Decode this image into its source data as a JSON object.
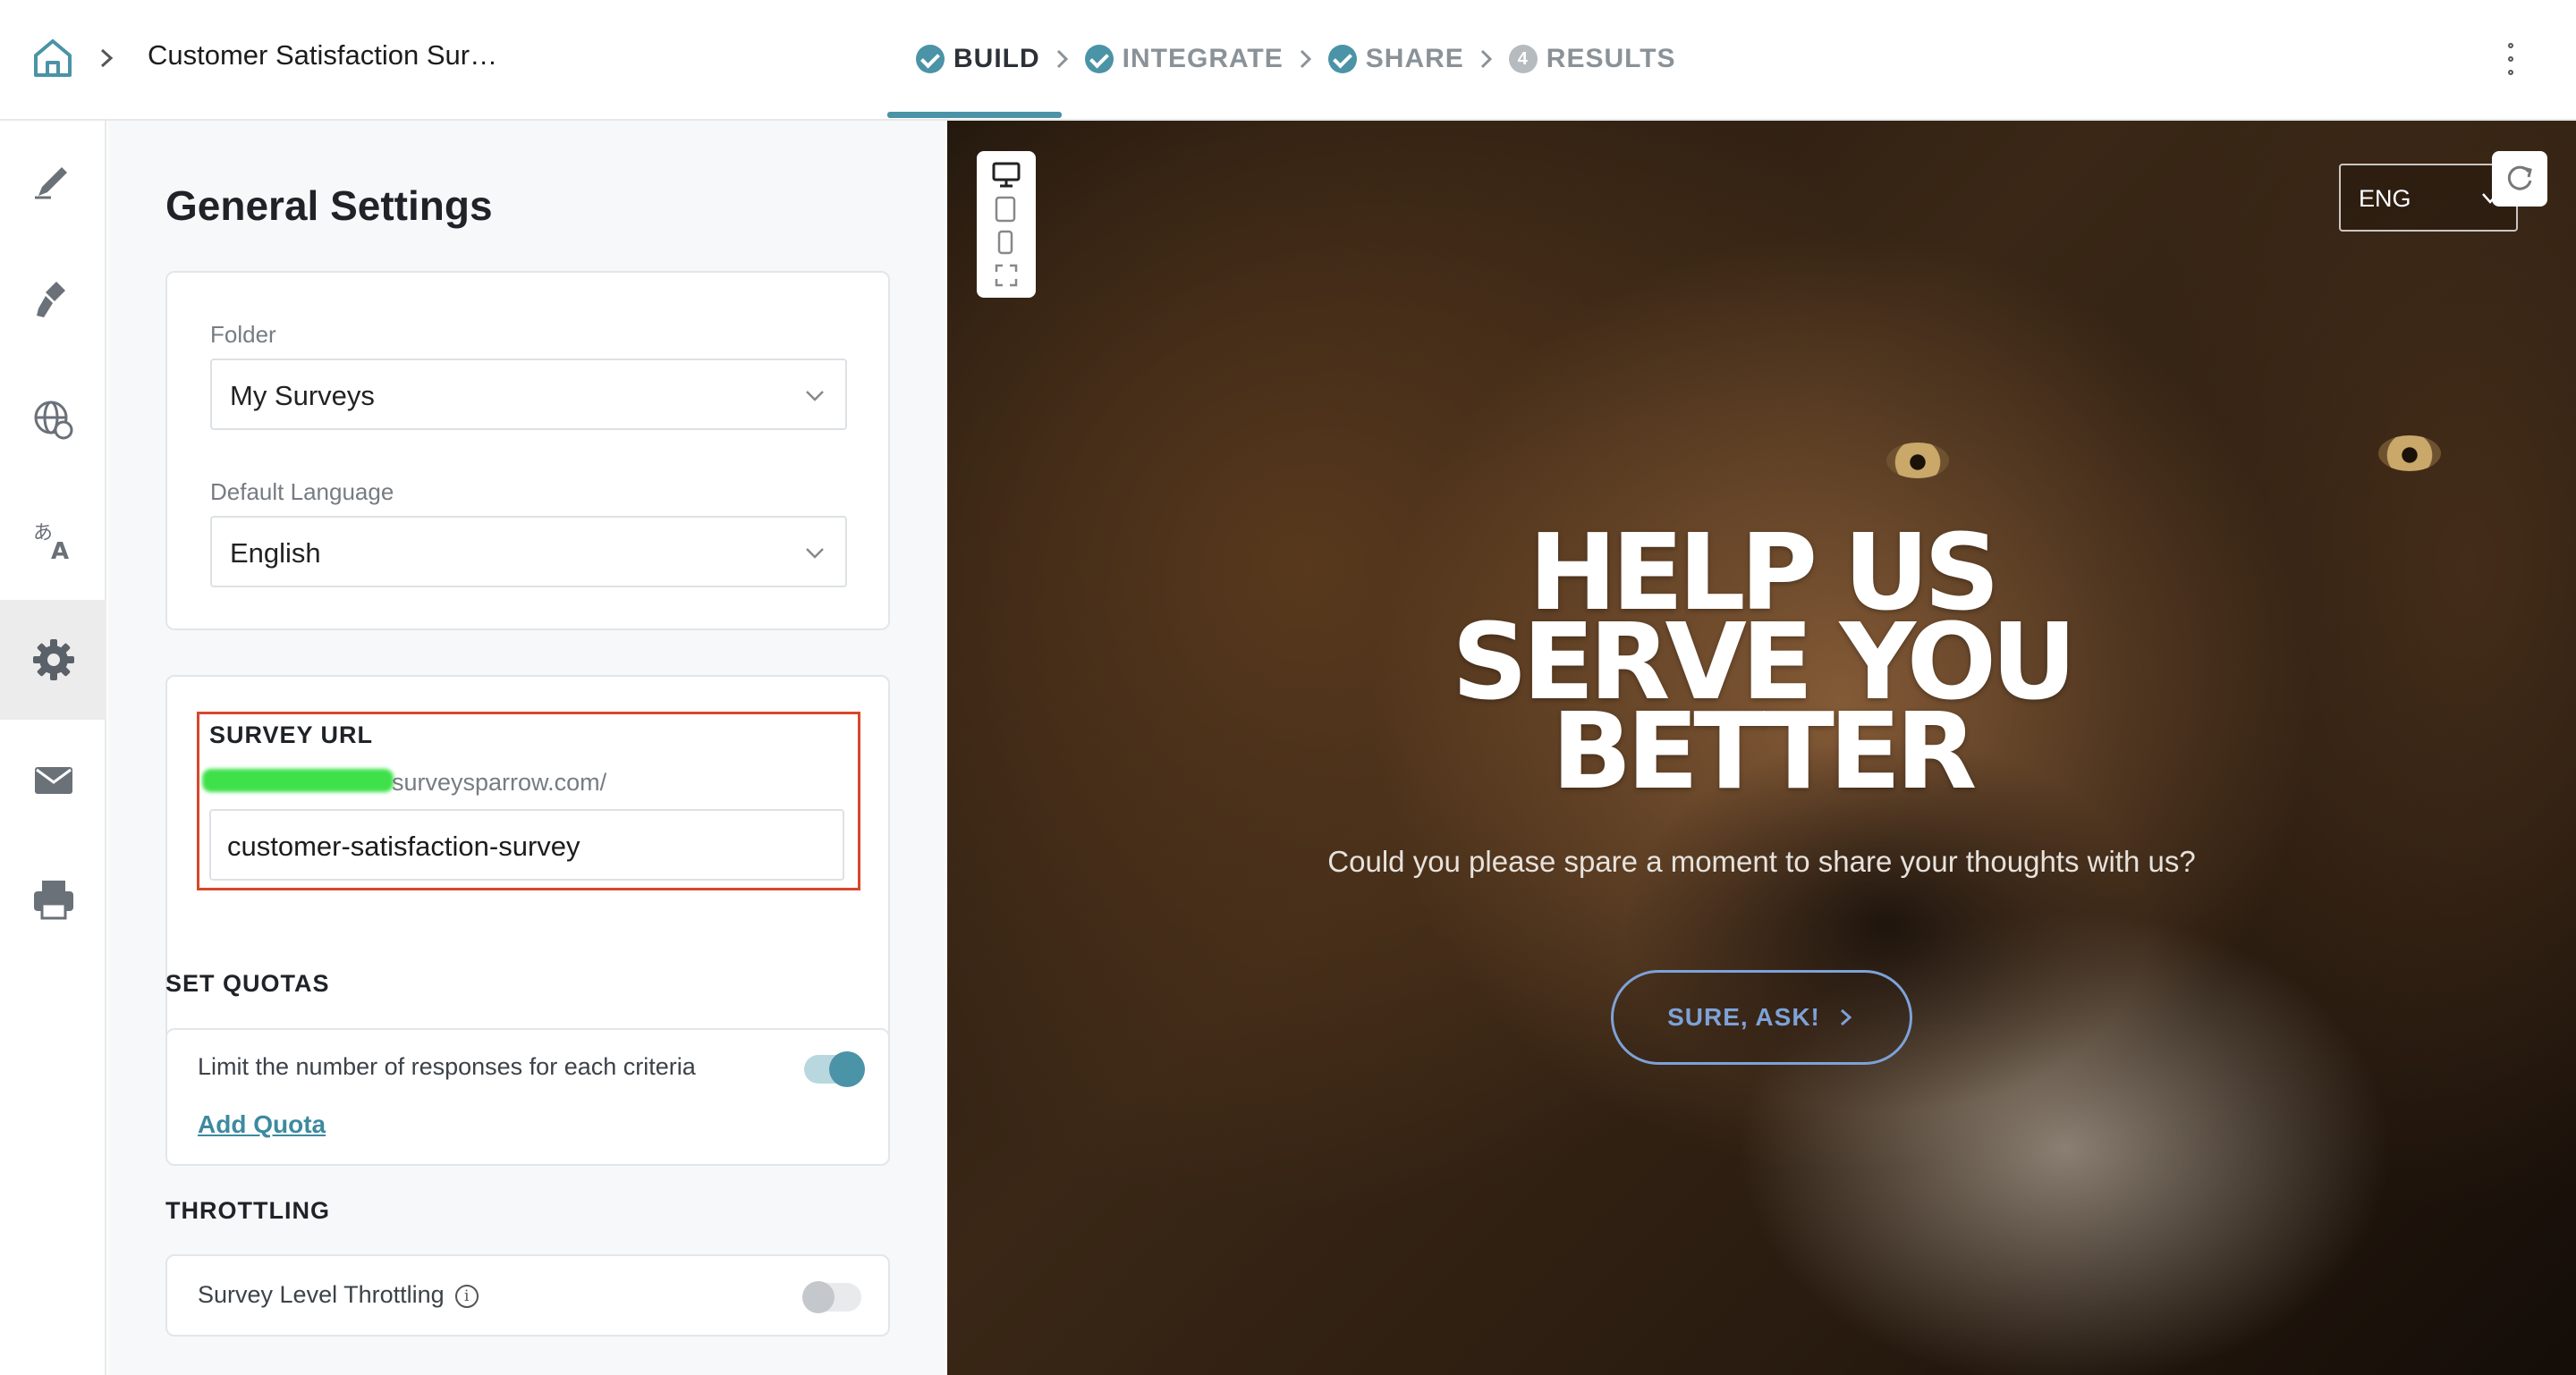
{
  "header": {
    "survey_title": "Customer Satisfaction Sur…",
    "steps": [
      {
        "label": "BUILD",
        "state": "done-active"
      },
      {
        "label": "INTEGRATE",
        "state": "done"
      },
      {
        "label": "SHARE",
        "state": "done"
      },
      {
        "label": "RESULTS",
        "number": "4",
        "state": "todo"
      }
    ]
  },
  "rail": {
    "items": [
      {
        "icon": "pencil-icon"
      },
      {
        "icon": "paint-brush-icon"
      },
      {
        "icon": "globe-settings-icon"
      },
      {
        "icon": "translate-icon"
      },
      {
        "icon": "gear-icon",
        "active": true
      },
      {
        "icon": "mail-icon"
      },
      {
        "icon": "printer-icon"
      }
    ]
  },
  "settings": {
    "title": "General Settings",
    "folder_label": "Folder",
    "folder_value": "My Surveys",
    "language_label": "Default Language",
    "language_value": "English",
    "survey_url_label": "SURVEY URL",
    "survey_url_domain": "surveysparrow.com/",
    "survey_url_slug": "customer-satisfaction-survey",
    "quotas_heading": "SET QUOTAS",
    "quotas_text": "Limit the number of responses for each criteria",
    "quotas_enabled": true,
    "add_quota_label": "Add Quota",
    "throttling_heading": "THROTTLING",
    "throttling_text": "Survey Level Throttling",
    "throttling_enabled": false
  },
  "preview": {
    "language": "ENG",
    "headline_lines": [
      "HELP US",
      "SERVE YOU",
      "BETTER"
    ],
    "subtitle": "Could you please spare a moment to share your thoughts with us?",
    "cta_label": "SURE, ASK!"
  },
  "colors": {
    "accent": "#4b93a6",
    "highlight_border": "#d9472b",
    "cta": "#7da2d8"
  }
}
